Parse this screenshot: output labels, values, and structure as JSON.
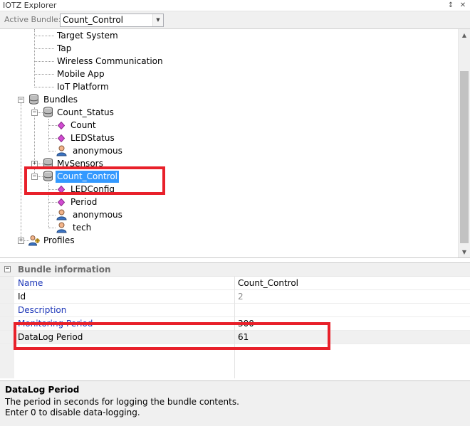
{
  "window": {
    "title": "IOTZ Explorer",
    "pin_glyph": "↕",
    "close_glyph": "✕"
  },
  "bundle_bar": {
    "label": "Active Bundle:",
    "selected": "Count_Control",
    "arrow_glyph": "▼"
  },
  "tree": {
    "items": [
      {
        "label": "Target System"
      },
      {
        "label": "Tap"
      },
      {
        "label": "Wireless Communication"
      },
      {
        "label": "Mobile App"
      },
      {
        "label": "IoT Platform"
      },
      {
        "label": "Bundles",
        "icon": "database-icon",
        "expander": "−"
      },
      {
        "label": "Count_Status",
        "icon": "database-icon",
        "expander": "−"
      },
      {
        "label": "Count",
        "icon": "diamond-icon"
      },
      {
        "label": "LEDStatus",
        "icon": "diamond-icon"
      },
      {
        "label": "anonymous",
        "icon": "user-icon"
      },
      {
        "label": "MySensors",
        "icon": "database-icon",
        "expander": "+"
      },
      {
        "label": "Count_Control",
        "icon": "database-icon",
        "expander": "−",
        "selected": true
      },
      {
        "label": "LEDConfig",
        "icon": "diamond-icon"
      },
      {
        "label": "Period",
        "icon": "diamond-icon"
      },
      {
        "label": "anonymous",
        "icon": "user-icon"
      },
      {
        "label": "tech",
        "icon": "user-icon"
      },
      {
        "label": "Profiles",
        "icon": "profiles-icon",
        "expander": "+"
      }
    ]
  },
  "scrollbar": {
    "up_glyph": "▲",
    "down_glyph": "▼"
  },
  "properties": {
    "category": "Bundle information",
    "category_expander": "−",
    "rows": [
      {
        "name": "Name",
        "value": "Count_Control"
      },
      {
        "name": "Id",
        "value": "2"
      },
      {
        "name": "Description",
        "value": ""
      },
      {
        "name": "Monitoring Period",
        "value": "300"
      },
      {
        "name": "DataLog Period",
        "value": "61"
      }
    ]
  },
  "help": {
    "title": "DataLog Period",
    "line1": "The period in seconds for logging the bundle contents.",
    "line2": "Enter 0 to disable data-logging."
  },
  "colors": {
    "selection": "#3399ff",
    "highlight_box": "#e8202a",
    "link_blue": "#1c36b8",
    "diamond": "#cc44cc"
  }
}
